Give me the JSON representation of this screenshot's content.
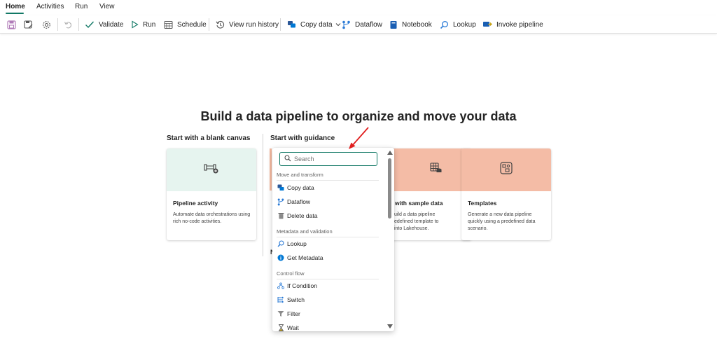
{
  "tabs": [
    {
      "label": "Home"
    },
    {
      "label": "Activities"
    },
    {
      "label": "Run"
    },
    {
      "label": "View"
    }
  ],
  "toolbar": {
    "validate": "Validate",
    "run": "Run",
    "schedule": "Schedule",
    "view_run_history": "View run history",
    "copy_data": "Copy data",
    "dataflow": "Dataflow",
    "notebook": "Notebook",
    "lookup": "Lookup",
    "invoke_pipeline": "Invoke pipeline"
  },
  "main": {
    "headline": "Build a data pipeline to organize and move your data",
    "blank_section": "Start with a blank canvas",
    "guidance_section": "Start with guidance",
    "cards": {
      "pipeline_activity": {
        "title": "Pipeline activity",
        "description": "Automate data orchestrations using rich no-code activities."
      },
      "sample_data": {
        "title": "with sample data",
        "description": "uild a data pipeline\nedefined template to\ninto Lakehouse."
      },
      "templates": {
        "title": "Templates",
        "description": "Generate a new data pipeline quickly using a predefined data scenario."
      }
    },
    "partial_label": "N"
  },
  "dropdown": {
    "search_placeholder": "Search",
    "groups": [
      {
        "label": "Move and transform",
        "items": [
          "Copy data",
          "Dataflow",
          "Delete data"
        ]
      },
      {
        "label": "Metadata and validation",
        "items": [
          "Lookup",
          "Get Metadata"
        ]
      },
      {
        "label": "Control flow",
        "items": [
          "If Condition",
          "Switch",
          "Filter",
          "Wait"
        ]
      }
    ]
  },
  "colors": {
    "accent": "#117865",
    "blank_card_banner": "#e6f4ef",
    "guidance_card_banner": "#f4bca6",
    "annotation_arrow": "#e01e1e"
  },
  "icons": {
    "save": "save-icon",
    "save_as": "save-as-icon",
    "settings": "gear-icon",
    "undo": "undo-icon",
    "validate": "checkmark-icon",
    "run": "play-icon",
    "schedule": "calendar-icon",
    "history": "history-icon",
    "copy_data": "copy-data-icon",
    "dataflow": "dataflow-icon",
    "notebook": "notebook-icon",
    "lookup": "lookup-icon",
    "invoke_pipeline": "invoke-pipeline-icon"
  }
}
